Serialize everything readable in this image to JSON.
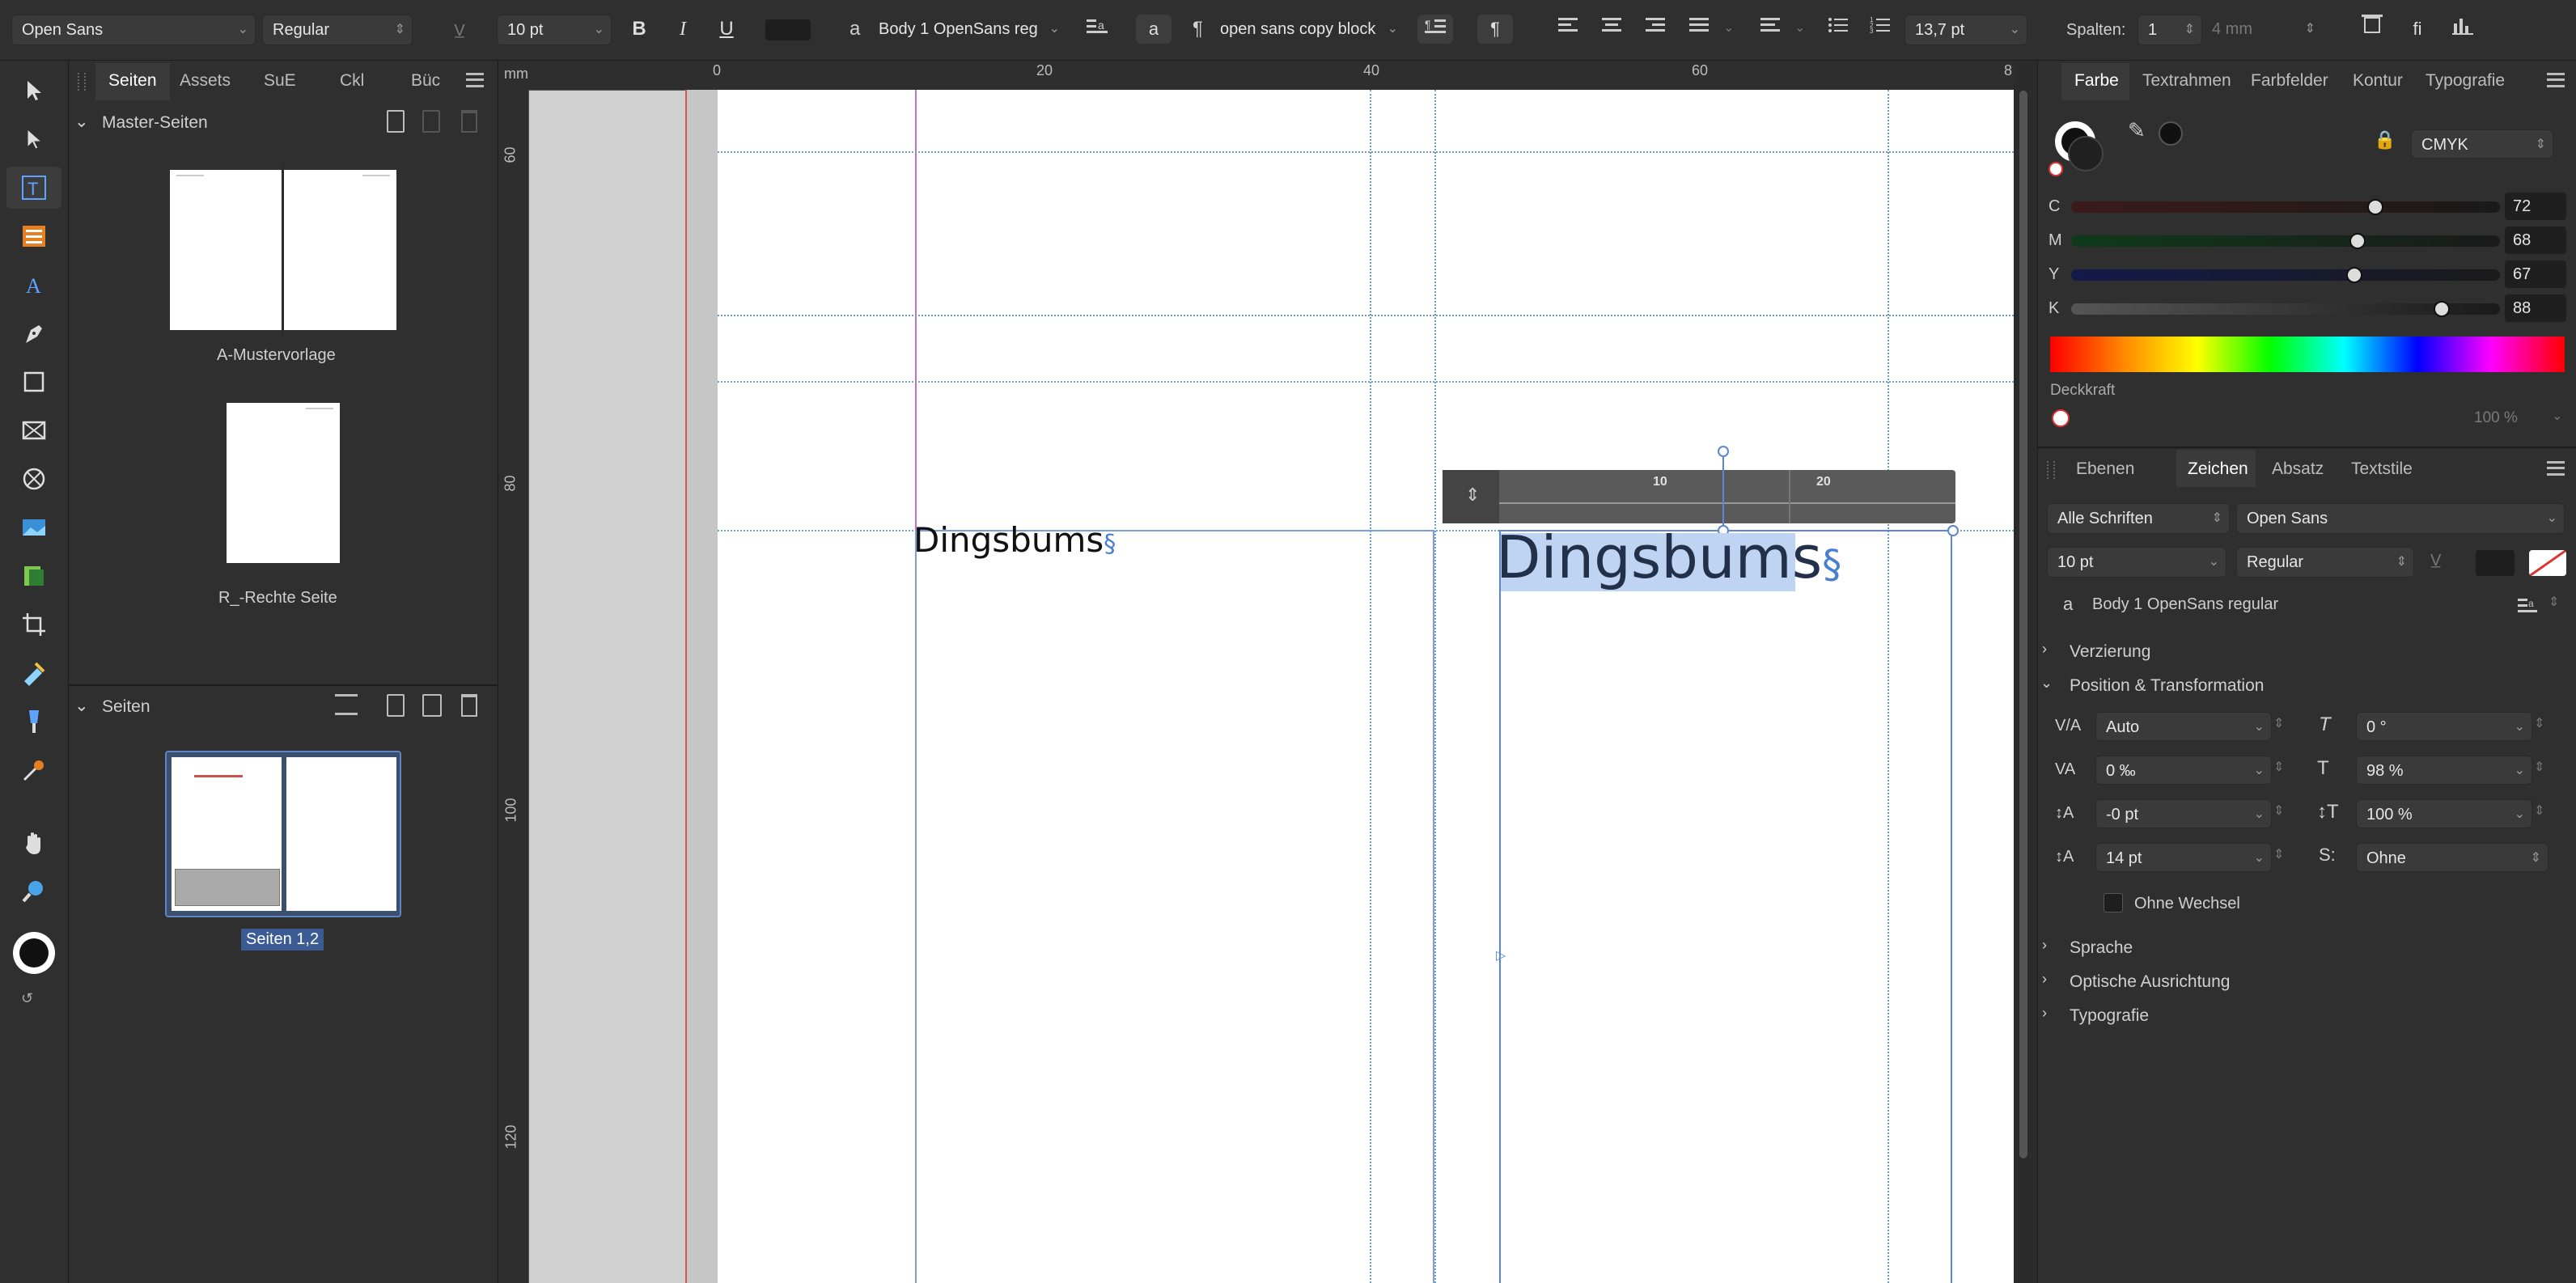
{
  "toolbar": {
    "font": "Open Sans",
    "style": "Regular",
    "size": "10 pt",
    "bold": "B",
    "italic": "I",
    "underline": "U",
    "char_style_icon": "a",
    "char_style": "Body 1 OpenSans reg",
    "para_style_mark": "¶",
    "para_style": "open sans copy block",
    "leading": "13,7 pt",
    "columns_label": "Spalten:",
    "columns": "1",
    "gutter": "4 mm"
  },
  "left_panel": {
    "tabs": [
      "Seiten",
      "Assets",
      "SuE",
      "Ckl",
      "Büc"
    ],
    "masters_header": "Master-Seiten",
    "master_a": "A-Mustervorlage",
    "master_r": "R_-Rechte Seite",
    "pages_header": "Seiten",
    "pages_selected": "Seiten 1,2"
  },
  "ruler": {
    "unit": "mm",
    "h_ticks": [
      "0",
      "20",
      "40",
      "60",
      "8"
    ],
    "v_ticks": [
      "60",
      "80",
      "100",
      "120"
    ],
    "inline_ticks": [
      "10",
      "20"
    ]
  },
  "canvas": {
    "left_text": "Dingsbums",
    "right_text": "Dingsbums",
    "pilcrow": "§"
  },
  "color_panel": {
    "tabs": [
      "Farbe",
      "Textrahmen",
      "Farbfelder",
      "Kontur",
      "Typografie"
    ],
    "model": "CMYK",
    "channels": [
      {
        "label": "C",
        "value": "72"
      },
      {
        "label": "M",
        "value": "68"
      },
      {
        "label": "Y",
        "value": "67"
      },
      {
        "label": "K",
        "value": "88"
      }
    ],
    "opacity_label": "Deckkraft",
    "opacity_value": "100 %"
  },
  "char_panel": {
    "tabs": [
      "Ebenen",
      "Zeichen",
      "Absatz",
      "Textstile"
    ],
    "font_collection": "Alle Schriften",
    "font": "Open Sans",
    "size": "10 pt",
    "style": "Regular",
    "char_style": "Body 1 OpenSans regular",
    "sections": {
      "ornament": "Verzierung",
      "position": "Position & Transformation",
      "language": "Sprache",
      "optical": "Optische Ausrichtung",
      "typography": "Typografie"
    },
    "kerning": "Auto",
    "shear": "0 °",
    "tracking": "0 ‰",
    "hscale": "98 %",
    "baseline": "-0 pt",
    "vscale": "100 %",
    "leading": "14 pt",
    "superscript": "Ohne",
    "no_break": "Ohne Wechsel"
  }
}
